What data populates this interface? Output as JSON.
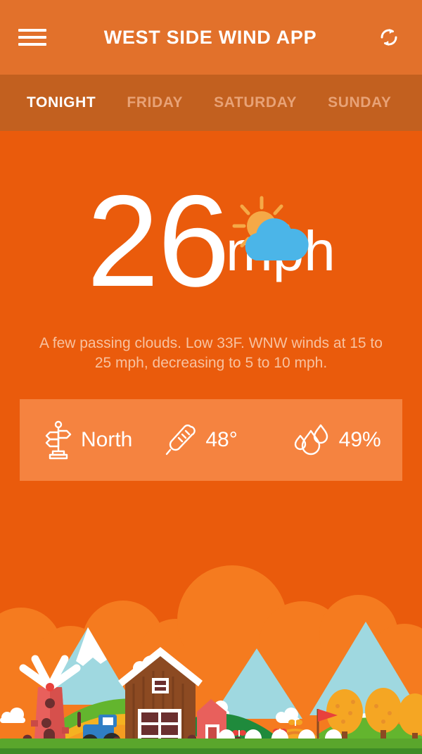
{
  "header": {
    "menu_icon": "hamburger-icon",
    "title": "WEST SIDE WIND APP",
    "refresh_icon": "refresh-icon",
    "background": "#e2712b"
  },
  "tabs": {
    "background": "#c2601f",
    "active_color": "#ffffff",
    "inactive_color": "#e8a276",
    "items": [
      {
        "label": "TONIGHT",
        "active": true
      },
      {
        "label": "FRIDAY",
        "active": false
      },
      {
        "label": "SATURDAY",
        "active": false
      },
      {
        "label": "SUNDAY",
        "active": false
      }
    ]
  },
  "current": {
    "value": "26",
    "unit": "mph",
    "condition_icon": "sun-behind-cloud-icon",
    "description": "A few passing clouds. Low 33F. WNW winds at 15 to 25 mph, decreasing to 5 to 10 mph.",
    "background": "#ea5b0c"
  },
  "stats": {
    "background": "#f58340",
    "items": [
      {
        "icon": "signpost-icon",
        "label": "North"
      },
      {
        "icon": "thermometer-icon",
        "label": "48°"
      },
      {
        "icon": "water-drops-icon",
        "label": "49%"
      }
    ]
  },
  "illustration": {
    "name": "farm-landscape-illustration",
    "colors": {
      "sky": "#ea5b0c",
      "clouds_orange": "#f57b1f",
      "clouds_white": "#ffffff",
      "ground_green": "#5aa62c",
      "ground_dark_green": "#3e8b26",
      "hill_green": "#63b52e",
      "field_yellow": "#f5b221",
      "mountain_blue": "#9fd8e0",
      "barn_brown": "#8c4a22",
      "windmill_red": "#e8605c",
      "tractor_blue": "#2f7ec4",
      "tree_orange": "#f5a623",
      "flag_red": "#e8413c",
      "soil_brown": "#6b2f2f"
    }
  }
}
